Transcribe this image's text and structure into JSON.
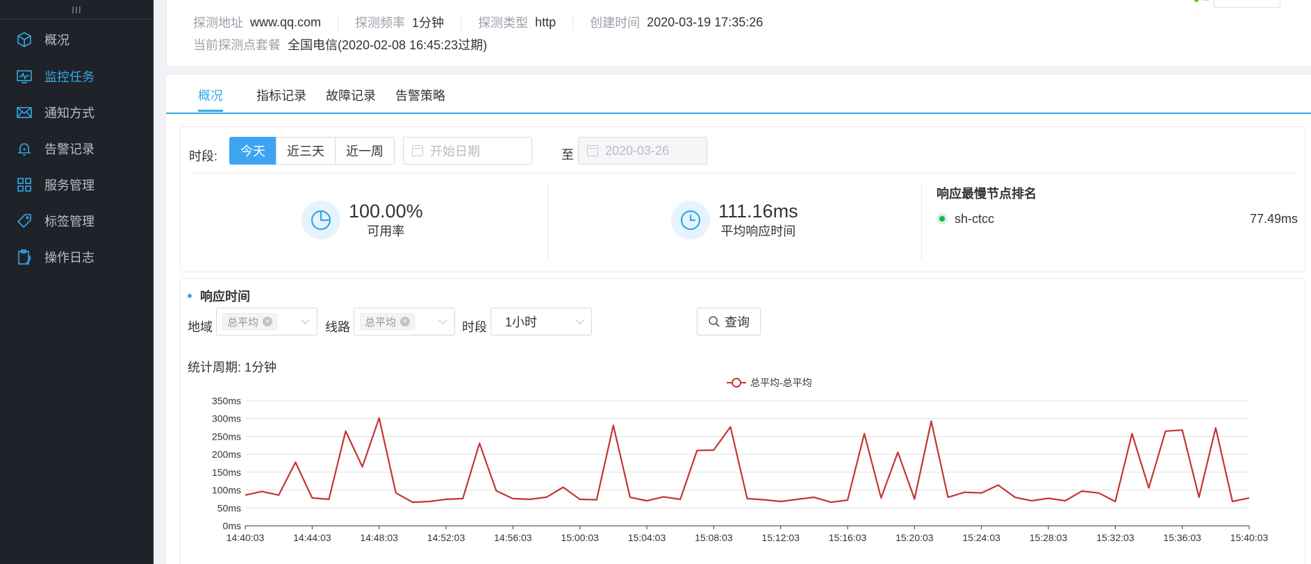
{
  "sidebar": {
    "collapse_glyph": "III",
    "items": [
      {
        "label": "概况",
        "icon": "cube-icon",
        "active": false
      },
      {
        "label": "监控任务",
        "icon": "monitor-icon",
        "active": true
      },
      {
        "label": "通知方式",
        "icon": "mail-icon",
        "active": false
      },
      {
        "label": "告警记录",
        "icon": "bell-icon",
        "active": false
      },
      {
        "label": "服务管理",
        "icon": "grid-icon",
        "active": false
      },
      {
        "label": "标签管理",
        "icon": "tag-icon",
        "active": false
      },
      {
        "label": "操作日志",
        "icon": "clipboard-icon",
        "active": false
      }
    ]
  },
  "task_info": {
    "address_label": "探测地址",
    "address": "www.qq.com",
    "frequency_label": "探测频率",
    "frequency": "1分钟",
    "type_label": "探测类型",
    "type": "http",
    "created_label": "创建时间",
    "created": "2020-03-19 17:35:26",
    "package_label": "当前探测点套餐",
    "package": "全国电信(2020-02-08 16:45:23过期)"
  },
  "tabs": [
    "概况",
    "指标记录",
    "故障记录",
    "告警策略"
  ],
  "filters": {
    "period_label": "时段:",
    "period_options": [
      "今天",
      "近三天",
      "近一周"
    ],
    "start_placeholder": "开始日期",
    "to_label": "至",
    "end_date": "2020-03-26"
  },
  "stats": {
    "availability": "100.00%",
    "availability_label": "可用率",
    "avg_response": "111.16ms",
    "avg_response_label": "平均响应时间"
  },
  "ranking": {
    "title": "响应最慢节点排名",
    "items": [
      {
        "node": "sh-ctcc",
        "value": "77.49ms"
      }
    ]
  },
  "chart_section": {
    "title": "响应时间",
    "region_label": "地域",
    "region_tag": "总平均",
    "line_label": "线路",
    "line_tag": "总平均",
    "period_label": "时段",
    "period_value": "1小时",
    "query_label": "查询",
    "stat_period": "统计周期: 1分钟"
  },
  "colors": {
    "accent": "#35a8e8",
    "series": "#c23531",
    "sidebar_bg": "#1f2329"
  },
  "chart_data": {
    "type": "line",
    "legend": [
      "总平均-总平均"
    ],
    "y_ticks": [
      "0ms",
      "50ms",
      "100ms",
      "150ms",
      "200ms",
      "250ms",
      "300ms",
      "350ms"
    ],
    "x_ticks": [
      "14:40:03",
      "14:44:03",
      "14:48:03",
      "14:52:03",
      "14:56:03",
      "15:00:03",
      "15:04:03",
      "15:08:03",
      "15:12:03",
      "15:16:03",
      "15:20:03",
      "15:24:03",
      "15:28:03",
      "15:32:03",
      "15:36:03",
      "15:40:03"
    ],
    "ylim": [
      0,
      350
    ],
    "grid": true,
    "legend_position": "top",
    "series": [
      {
        "name": "总平均-总平均",
        "values": [
          86,
          96,
          86,
          178,
          78,
          74,
          265,
          165,
          302,
          92,
          66,
          68,
          74,
          76,
          231,
          98,
          76,
          74,
          80,
          108,
          74,
          73,
          281,
          80,
          70,
          81,
          74,
          211,
          212,
          277,
          76,
          73,
          68,
          74,
          80,
          66,
          72,
          258,
          78,
          206,
          75,
          293,
          80,
          94,
          92,
          114,
          80,
          70,
          77,
          70,
          97,
          92,
          68,
          258,
          106,
          265,
          268,
          80,
          274,
          68,
          78
        ]
      }
    ]
  }
}
